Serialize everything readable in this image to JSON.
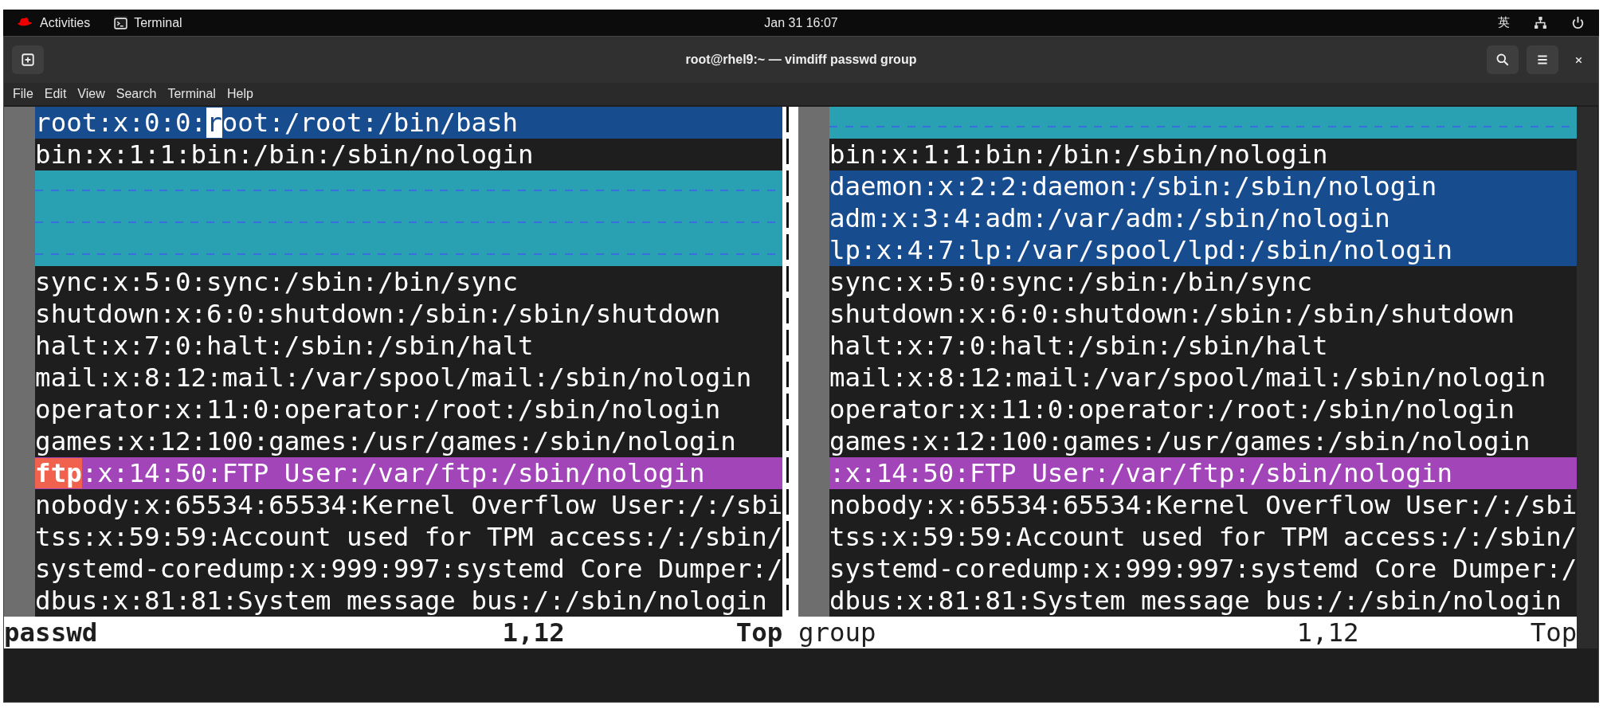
{
  "top_bar": {
    "activities": "Activities",
    "app": "Terminal",
    "clock": "Jan 31  16:07",
    "input_method": "英"
  },
  "window": {
    "title": "root@rhel9:~ — vimdiff passwd group"
  },
  "menu": [
    "File",
    "Edit",
    "View",
    "Search",
    "Terminal",
    "Help"
  ],
  "panes": [
    {
      "lines": [
        {
          "kind": "added",
          "segments": [
            {
              "text": "root:x:0:0:",
              "kind": "plain"
            },
            {
              "text": "r",
              "kind": "cursor"
            },
            {
              "text": "oot:/root:/bin/bash",
              "kind": "plain"
            }
          ]
        },
        {
          "kind": "plain",
          "text": "bin:x:1:1:bin:/bin:/sbin/nologin"
        },
        {
          "kind": "filler"
        },
        {
          "kind": "filler"
        },
        {
          "kind": "filler"
        },
        {
          "kind": "plain",
          "text": "sync:x:5:0:sync:/sbin:/bin/sync"
        },
        {
          "kind": "plain",
          "text": "shutdown:x:6:0:shutdown:/sbin:/sbin/shutdown"
        },
        {
          "kind": "plain",
          "text": "halt:x:7:0:halt:/sbin:/sbin/halt"
        },
        {
          "kind": "plain",
          "text": "mail:x:8:12:mail:/var/spool/mail:/sbin/nologin"
        },
        {
          "kind": "plain",
          "text": "operator:x:11:0:operator:/root:/sbin/nologin"
        },
        {
          "kind": "plain",
          "text": "games:x:12:100:games:/usr/games:/sbin/nologin"
        },
        {
          "kind": "changed",
          "segments": [
            {
              "text": "ftp",
              "kind": "diff-text"
            },
            {
              "text": ":x:14:50:FTP User:/var/ftp:/sbin/nologin",
              "kind": "plain"
            }
          ]
        },
        {
          "kind": "plain",
          "text": "nobody:x:65534:65534:Kernel Overflow User:/:/sbi"
        },
        {
          "kind": "plain",
          "text": "tss:x:59:59:Account used for TPM access:/:/sbin/"
        },
        {
          "kind": "plain",
          "text": "systemd-coredump:x:999:997:systemd Core Dumper:/"
        },
        {
          "kind": "plain",
          "text": "dbus:x:81:81:System message bus:/:/sbin/nologin"
        }
      ],
      "status": {
        "name": "passwd",
        "ruler": "1,12",
        "position": "Top",
        "active": true
      }
    },
    {
      "lines": [
        {
          "kind": "filler"
        },
        {
          "kind": "plain",
          "text": "bin:x:1:1:bin:/bin:/sbin/nologin"
        },
        {
          "kind": "added",
          "text": "daemon:x:2:2:daemon:/sbin:/sbin/nologin"
        },
        {
          "kind": "added",
          "text": "adm:x:3:4:adm:/var/adm:/sbin/nologin"
        },
        {
          "kind": "added",
          "text": "lp:x:4:7:lp:/var/spool/lpd:/sbin/nologin"
        },
        {
          "kind": "plain",
          "text": "sync:x:5:0:sync:/sbin:/bin/sync"
        },
        {
          "kind": "plain",
          "text": "shutdown:x:6:0:shutdown:/sbin:/sbin/shutdown"
        },
        {
          "kind": "plain",
          "text": "halt:x:7:0:halt:/sbin:/sbin/halt"
        },
        {
          "kind": "plain",
          "text": "mail:x:8:12:mail:/var/spool/mail:/sbin/nologin"
        },
        {
          "kind": "plain",
          "text": "operator:x:11:0:operator:/root:/sbin/nologin"
        },
        {
          "kind": "plain",
          "text": "games:x:12:100:games:/usr/games:/sbin/nologin"
        },
        {
          "kind": "changed",
          "text": ":x:14:50:FTP User:/var/ftp:/sbin/nologin"
        },
        {
          "kind": "plain",
          "text": "nobody:x:65534:65534:Kernel Overflow User:/:/sbi"
        },
        {
          "kind": "plain",
          "text": "tss:x:59:59:Account used for TPM access:/:/sbin/"
        },
        {
          "kind": "plain",
          "text": "systemd-coredump:x:999:997:systemd Core Dumper:/"
        },
        {
          "kind": "plain",
          "text": "dbus:x:81:81:System message bus:/:/sbin/nologin"
        }
      ],
      "status": {
        "name": "group",
        "ruler": "1,12",
        "position": "Top",
        "active": false
      }
    }
  ]
}
